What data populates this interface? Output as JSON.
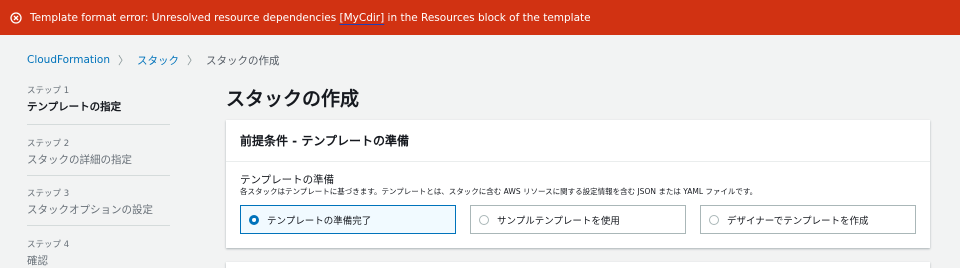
{
  "error_banner": {
    "text_before": "Template format error: Unresolved resource dependencies ",
    "highlight": "[MyCdir]",
    "text_after": " in the Resources block of the template"
  },
  "breadcrumb": {
    "items": [
      "CloudFormation",
      "スタック",
      "スタックの作成"
    ]
  },
  "steps": [
    {
      "number": "ステップ 1",
      "title": "テンプレートの指定"
    },
    {
      "number": "ステップ 2",
      "title": "スタックの詳細の指定"
    },
    {
      "number": "ステップ 3",
      "title": "スタックオプションの設定"
    },
    {
      "number": "ステップ 4",
      "title": "確認"
    }
  ],
  "page_title": "スタックの作成",
  "panel": {
    "header": "前提条件 - テンプレートの準備",
    "field_label": "テンプレートの準備",
    "field_desc": "各スタックはテンプレートに基づきます。テンプレートとは、スタックに含む AWS リソースに関する設定情報を含む JSON または YAML ファイルです。",
    "options": [
      {
        "label": "テンプレートの準備完了",
        "selected": true
      },
      {
        "label": "サンプルテンプレートを使用",
        "selected": false
      },
      {
        "label": "デザイナーでテンプレートを作成",
        "selected": false
      }
    ]
  }
}
